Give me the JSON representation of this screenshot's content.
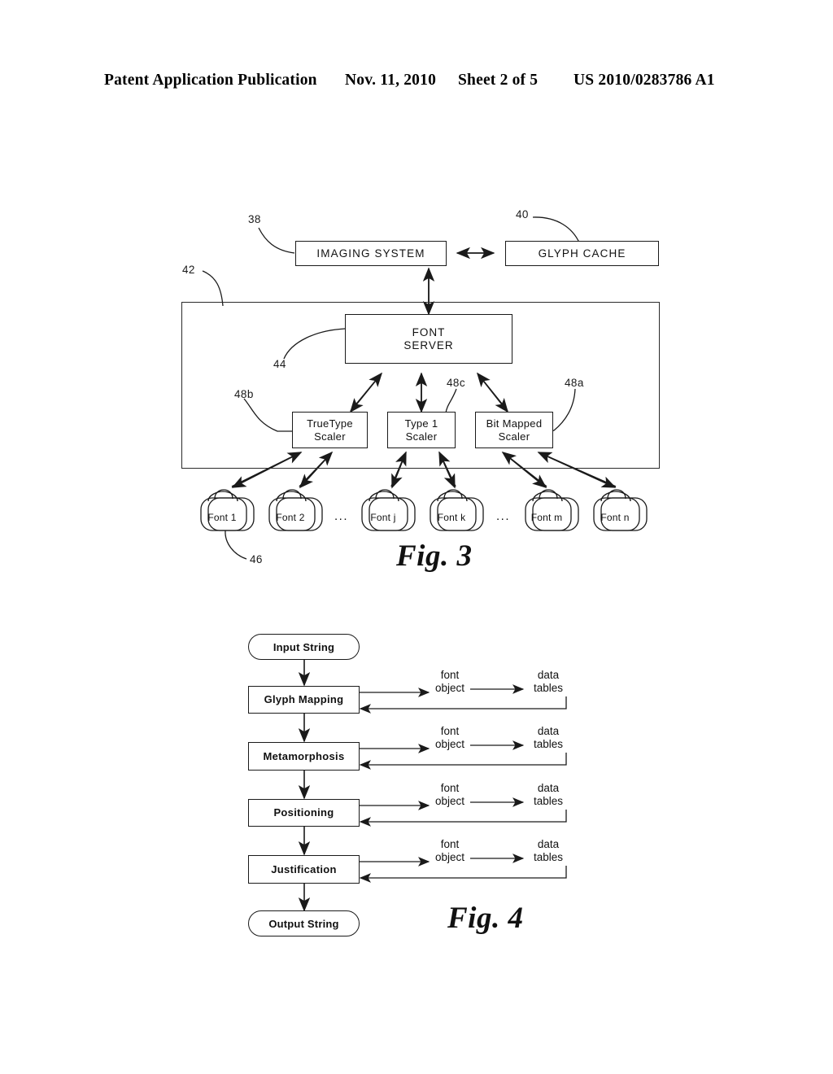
{
  "header": {
    "publication": "Patent Application Publication",
    "date": "Nov. 11, 2010",
    "sheet": "Sheet 2 of 5",
    "number": "US 2010/0283786 A1"
  },
  "figure3": {
    "caption": "Fig. 3",
    "boxes": {
      "imaging_system": "IMAGING SYSTEM",
      "glyph_cache": "GLYPH  CACHE",
      "font_server_line1": "FONT",
      "font_server_line2": "SERVER",
      "truetype_scaler_line1": "TrueType",
      "truetype_scaler_line2": "Scaler",
      "type1_scaler_line1": "Type 1",
      "type1_scaler_line2": "Scaler",
      "bitmapped_scaler_line1": "Bit Mapped",
      "bitmapped_scaler_line2": "Scaler"
    },
    "ref_numerals": {
      "imaging_system": "38",
      "glyph_cache": "40",
      "container": "42",
      "font_server": "44",
      "fonts": "46",
      "bitmapped_scaler": "48a",
      "truetype_scaler": "48b",
      "type1_scaler": "48c"
    },
    "fonts": [
      {
        "label": "Font 1"
      },
      {
        "label": "Font 2"
      },
      {
        "label": "Font j"
      },
      {
        "label": "Font k"
      },
      {
        "label": "Font m"
      },
      {
        "label": "Font n"
      }
    ],
    "ellipses": [
      "...",
      "..."
    ]
  },
  "figure4": {
    "caption": "Fig. 4",
    "start_terminal": "Input String",
    "end_terminal": "Output String",
    "steps": [
      {
        "label": "Glyph Mapping",
        "font_object": "font\nobject",
        "data_tables": "data\ntables"
      },
      {
        "label": "Metamorphosis",
        "font_object": "font\nobject",
        "data_tables": "data\ntables"
      },
      {
        "label": "Positioning",
        "font_object": "font\nobject",
        "data_tables": "data\ntables"
      },
      {
        "label": "Justification",
        "font_object": "font\nobject",
        "data_tables": "data\ntables"
      }
    ],
    "side_labels": {
      "font_object_line1": "font",
      "font_object_line2": "object",
      "data_tables_line1": "data",
      "data_tables_line2": "tables"
    }
  },
  "colors": {
    "ink": "#1a1a1a",
    "paper": "#ffffff"
  }
}
